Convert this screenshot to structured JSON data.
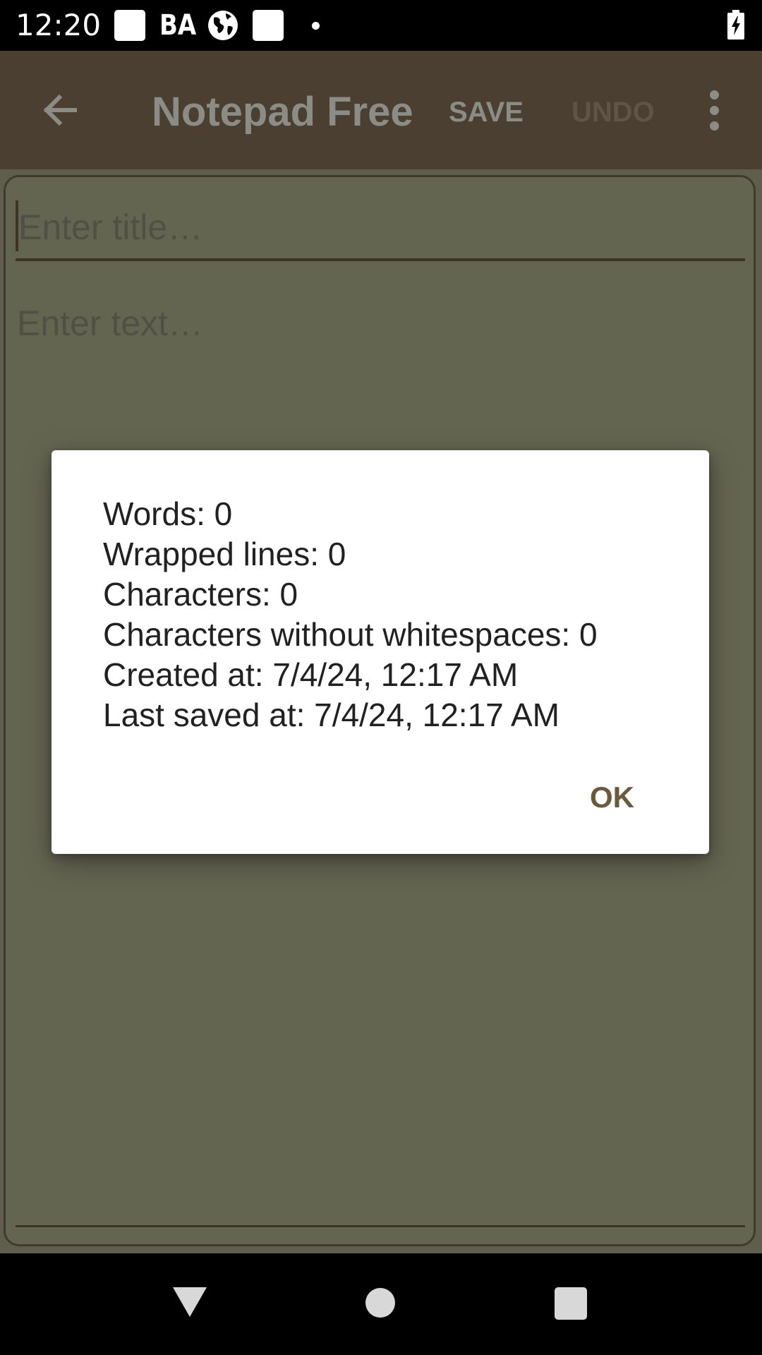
{
  "status_bar": {
    "time": "12:20",
    "carrier_text": "BA",
    "icons": [
      "notification-square-icon",
      "ba-icon",
      "globe-icon",
      "notification-square-icon",
      "dot-icon",
      "battery-charging-icon"
    ]
  },
  "toolbar": {
    "title": "Notepad Free",
    "save_label": "SAVE",
    "undo_label": "UNDO",
    "back_icon": "arrow-back-icon",
    "more_icon": "more-vert-icon"
  },
  "editor": {
    "title_placeholder": "Enter title…",
    "text_placeholder": "Enter text…"
  },
  "dialog": {
    "lines": [
      "Words: 0",
      "Wrapped lines: 0",
      "Characters: 0",
      "Characters without whitespaces: 0",
      "Created at: 7/4/24, 12:17 AM",
      "Last saved at: 7/4/24, 12:17 AM"
    ],
    "ok_label": "OK"
  },
  "nav_bar": {
    "icons": [
      "nav-back-icon",
      "nav-home-icon",
      "nav-recents-icon"
    ]
  },
  "colors": {
    "toolbar_bg": "#4a3f30",
    "editor_dim_bg": "#646551",
    "accent": "#6b5a3a",
    "dialog_bg": "#ffffff"
  }
}
